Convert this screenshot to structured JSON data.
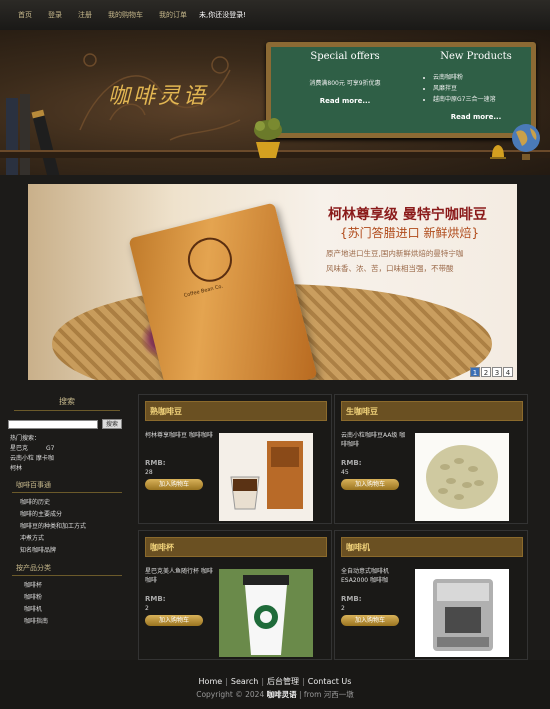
{
  "nav": {
    "items": [
      "首页",
      "登录",
      "注册",
      "我的购物车",
      "我的订单"
    ],
    "user_status": "未,你还没登录!"
  },
  "header": {
    "logo_text": "咖啡灵语",
    "special_offers": {
      "title": "Special offers",
      "text": "消费满800元 可享9折优惠",
      "more": "Read more..."
    },
    "new_products": {
      "title": "New Products",
      "items": [
        "云南咖啡粉",
        "风靡拌豆",
        "越南中原G7三合一速溶"
      ],
      "more": "Read more..."
    }
  },
  "hero": {
    "headline": "柯林尊享级 曼特宁咖啡豆",
    "subhead": "{苏门答腊进口 新鲜烘焙}",
    "body_line1": "原产地进口生豆,国内新鲜烘焙的曼特宁咖",
    "body_line2": "风味香、浓、苦，口味相当强，不带酸",
    "bag_label": "Coffee Bean Co.",
    "pager": [
      "1",
      "2",
      "3",
      "4"
    ],
    "active_page": "1"
  },
  "sidebar": {
    "search_title": "搜索",
    "search_button": "搜索",
    "hot_label": "热门搜索：",
    "hot_items": [
      "星巴克",
      "G7",
      "云南小粒 摩卡咖",
      "柯林"
    ],
    "section1_title": "咖啡百事通",
    "section1_items": [
      "咖啡的历史",
      "咖啡的主要成分",
      "咖啡豆的种类和加工方式",
      "冲煮方式",
      "知名咖啡品牌"
    ],
    "section2_title": "按产品分类",
    "section2_items": [
      "咖啡杯",
      "咖啡粉",
      "咖啡机",
      "咖啡指南"
    ]
  },
  "products": [
    {
      "category": "熟咖啡豆",
      "desc": "柯林尊享咖啡豆 咖啡咖啡",
      "rmb": "RMB:",
      "price": "28",
      "cart": "加入购物车"
    },
    {
      "category": "生咖啡豆",
      "desc": "云南小粒咖啡豆AA级 咖啡咖啡",
      "rmb": "RMB:",
      "price": "45",
      "cart": "加入购物车"
    },
    {
      "category": "咖啡杯",
      "desc": "星巴克美人鱼随行杯 咖啡咖啡",
      "rmb": "RMB:",
      "price": "2",
      "cart": "加入购物车"
    },
    {
      "category": "咖啡机",
      "desc": "全自动意式咖啡机 ESA2000 咖啡咖",
      "rmb": "RMB:",
      "price": "2",
      "cart": "加入购物车"
    }
  ],
  "footer": {
    "links": [
      "Home",
      "Search",
      "后台管理",
      "Contact Us"
    ],
    "copyright": "Copyright © 2024",
    "brand": "咖啡灵语",
    "from": "| from 河西一墩"
  },
  "colors": {
    "accent": "#c7b98c",
    "board": "#2f5f46",
    "header_bar": "#6a5022"
  }
}
